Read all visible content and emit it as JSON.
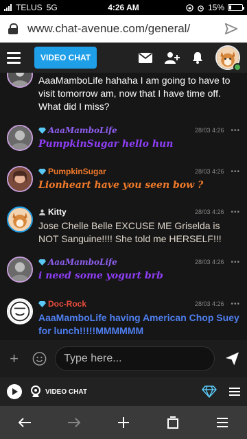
{
  "status": {
    "carrier": "TELUS",
    "network": "5G",
    "time": "4:26 AM",
    "battery": "15%",
    "battery_level": 0.15
  },
  "browser": {
    "url": "www.chat-avenue.com/general/"
  },
  "header": {
    "video_chat_label": "VIDEO CHAT",
    "accent": "#1e9fe8"
  },
  "messages": [
    {
      "name": "",
      "time": "",
      "text": "AaaMamboLife hahaha I am going to have to visit tomorrow am, now that I have time off. What did I miss?",
      "text_color": "#ffffff"
    },
    {
      "name": "AaaMamboLife",
      "name_color": "#8e5ef0",
      "time": "28/03 4:26",
      "text": "PumpkinSugar hello hun",
      "text_color": "#8e3ef5"
    },
    {
      "name": "PumpkinSugar",
      "name_color": "#f07a2b",
      "time": "28/03 4:26",
      "text": "Lionheart have you seen bow ?",
      "text_color": "#f07a2b"
    },
    {
      "name": "Kitty",
      "name_color": "#ffffff",
      "time": "28/03 4:26",
      "text": "Jose Chelle Belle EXCUSE ME Griselda is NOT Sanguine!!!! She told me HERSELF!!!",
      "text_color": "#e0d7cc"
    },
    {
      "name": "AaaMamboLife",
      "name_color": "#8e5ef0",
      "time": "28/03 4:26",
      "text": "i need some yogurt brb",
      "text_color": "#8e3ef5"
    },
    {
      "name": "Doc-Rock",
      "name_color": "#e84b3c",
      "time": "28/03 4:26",
      "text": "AaaMamboLife having American Chop Suey for lunch!!!!!MMMMMM",
      "text_color": "#4f7ff0"
    }
  ],
  "composer": {
    "placeholder": "Type here..."
  },
  "bottom": {
    "video_chat_label": "VIDEO CHAT"
  }
}
